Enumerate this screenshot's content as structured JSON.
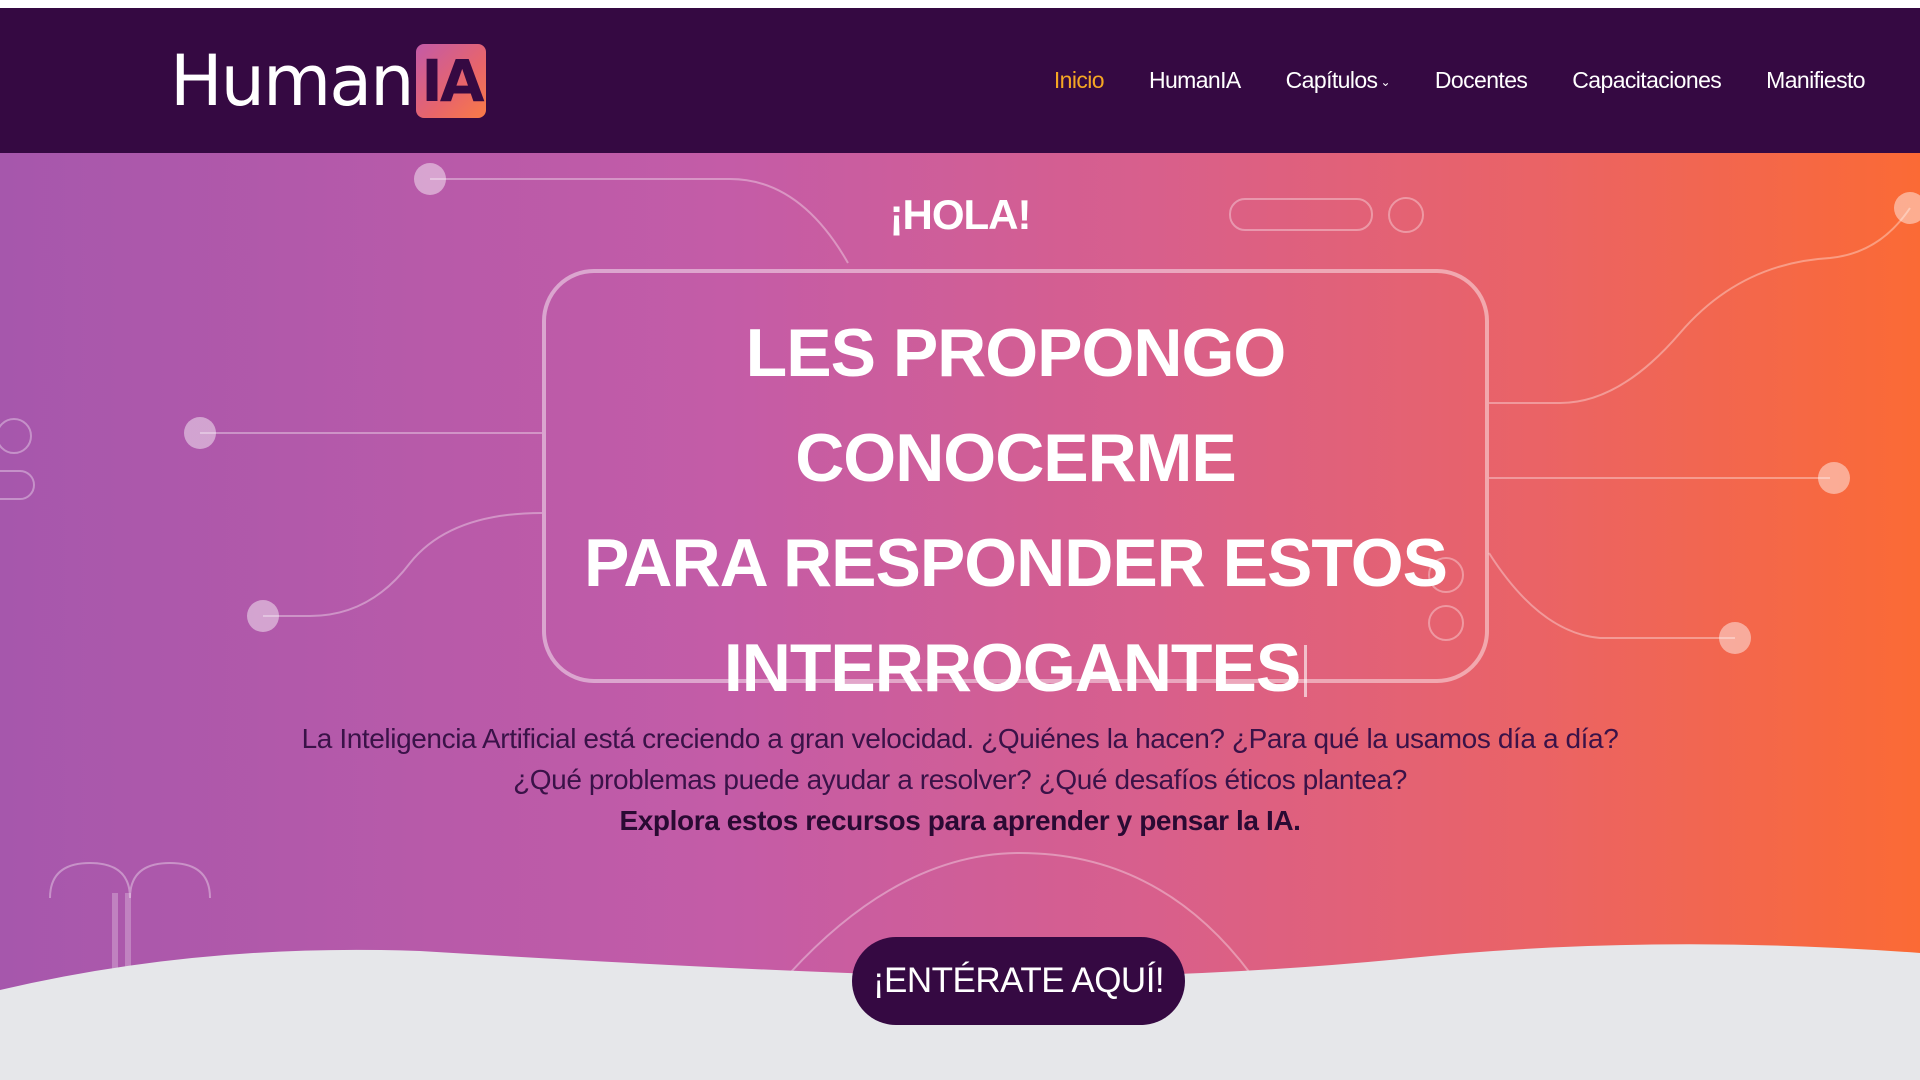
{
  "brand": {
    "name_text": "Human",
    "badge_text": "IA"
  },
  "nav": {
    "items": [
      {
        "label": "Inicio",
        "active": true
      },
      {
        "label": "HumanIA",
        "active": false
      },
      {
        "label": "Capítulos",
        "active": false,
        "has_dropdown": true
      },
      {
        "label": "Docentes",
        "active": false
      },
      {
        "label": "Capacitaciones",
        "active": false
      },
      {
        "label": "Manifiesto",
        "active": false
      }
    ]
  },
  "hero": {
    "greeting": "¡HOLA!",
    "headline_lines": [
      "LES PROPONGO CONOCERME",
      "PARA RESPONDER ESTOS",
      "INTERROGANTES"
    ],
    "description": "La Inteligencia Artificial está creciendo a gran velocidad. ¿Quiénes la hacen? ¿Para qué la usamos día a día? ¿Qué problemas puede ayudar a resolver? ¿Qué desafíos éticos plantea?",
    "description_strong": "Explora estos recursos para aprender y pensar la IA.",
    "cta_label": "¡ENTÉRATE AQUÍ!"
  },
  "colors": {
    "navbar_bg": "#350942",
    "active_nav": "#f5a623",
    "gradient_start": "#a657ac",
    "gradient_end": "#fb6a35",
    "cta_bg": "#350942",
    "wave_fill": "#e6e7ea"
  },
  "icons": {
    "dropdown": "chevron-down-icon"
  }
}
